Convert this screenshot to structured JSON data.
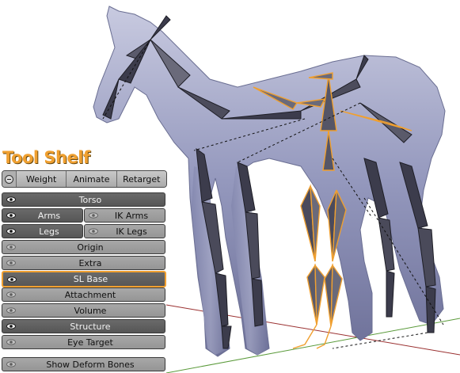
{
  "panel": {
    "title": "Tool Shelf"
  },
  "tabs": [
    "Weight",
    "Animate",
    "Retarget"
  ],
  "rows": [
    {
      "label": "Torso",
      "on": true
    },
    {
      "label": "Arms",
      "on": true
    },
    {
      "label": "IK Arms",
      "on": false
    },
    {
      "label": "Legs",
      "on": true
    },
    {
      "label": "IK Legs",
      "on": false
    },
    {
      "label": "Origin",
      "on": false
    },
    {
      "label": "Extra",
      "on": false
    },
    {
      "label": "SL Base",
      "on": true,
      "highlighted": true
    },
    {
      "label": "Attachment",
      "on": false
    },
    {
      "label": "Volume",
      "on": false
    },
    {
      "label": "Structure",
      "on": true
    },
    {
      "label": "Eye Target",
      "on": false
    },
    {
      "label": "Show Deform Bones",
      "on": false
    }
  ],
  "colors": {
    "accent": "#f0a030",
    "mesh": "#8b8fb8",
    "bone": "#3c3c4c",
    "selected_bone": "#f0a030"
  }
}
